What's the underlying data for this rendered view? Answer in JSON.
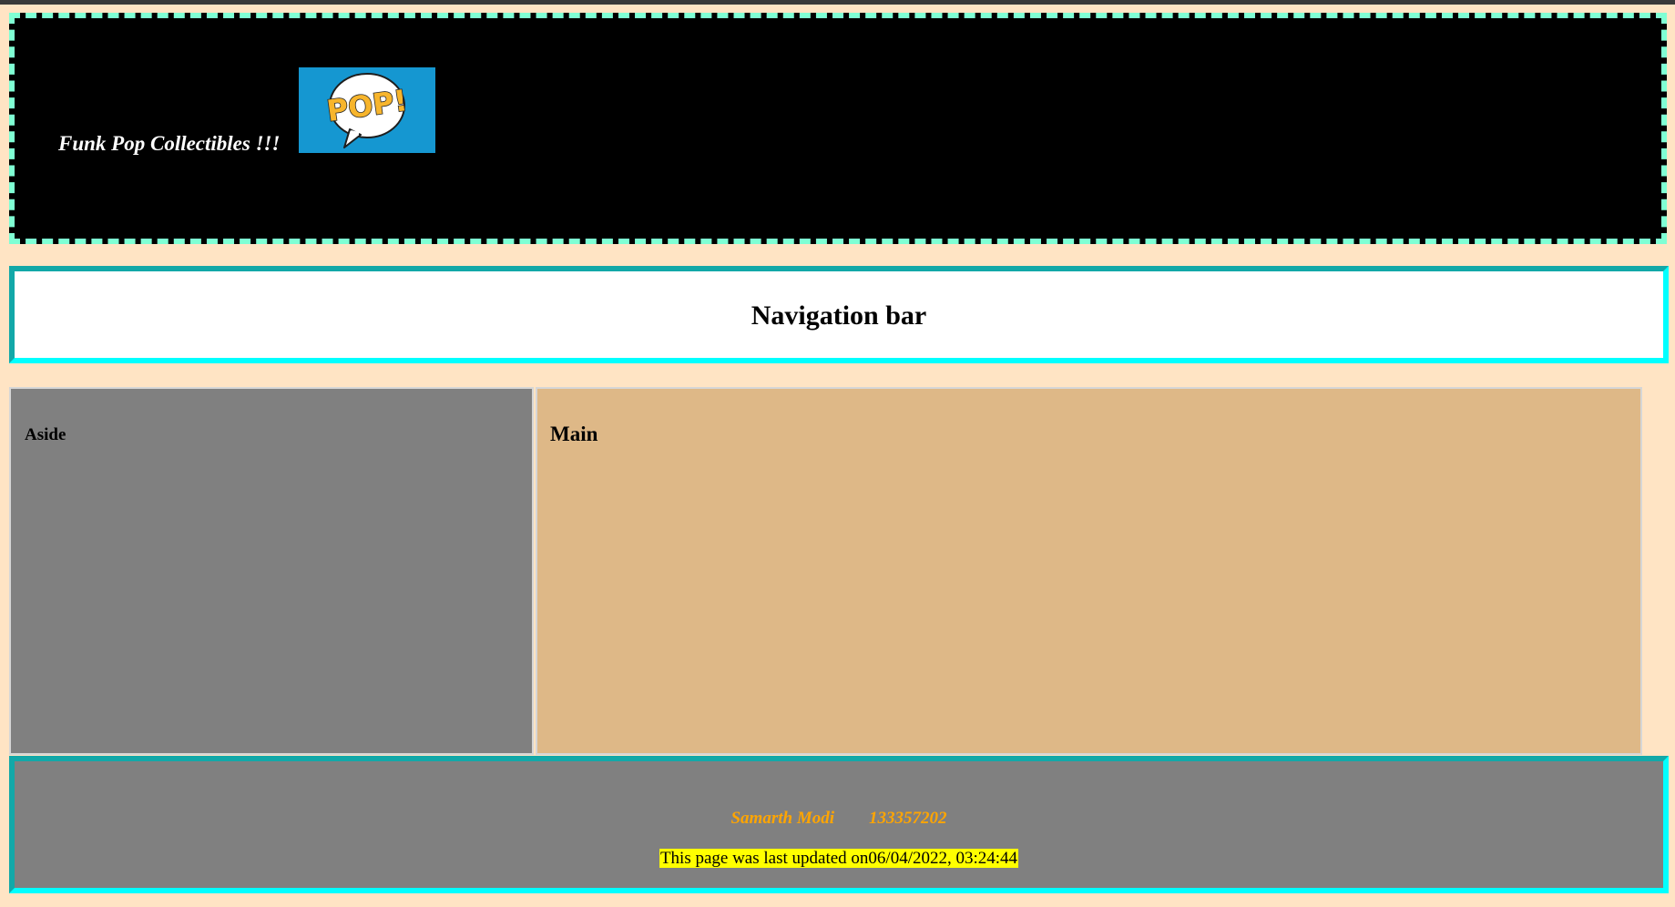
{
  "header": {
    "title": "Funk Pop Collectibles !!!",
    "logo": {
      "text": "POP!",
      "background": "#1597d1"
    }
  },
  "nav": {
    "title": "Navigation bar"
  },
  "aside": {
    "title": "Aside"
  },
  "main": {
    "title": "Main"
  },
  "footer": {
    "name": "Samarth Modi",
    "student_id": "133357202",
    "updated_label": "This page was last updated on",
    "updated_value": "06/04/2022, 03:24:44"
  },
  "colors": {
    "page_bg": "#ffe4c4",
    "header_bg": "#000000",
    "header_border": "#7fffd4",
    "nav_border": "#00ffff",
    "aside_bg": "#808080",
    "main_bg": "#deb887",
    "footer_text": "#ffa500",
    "highlight": "#ffff00"
  }
}
